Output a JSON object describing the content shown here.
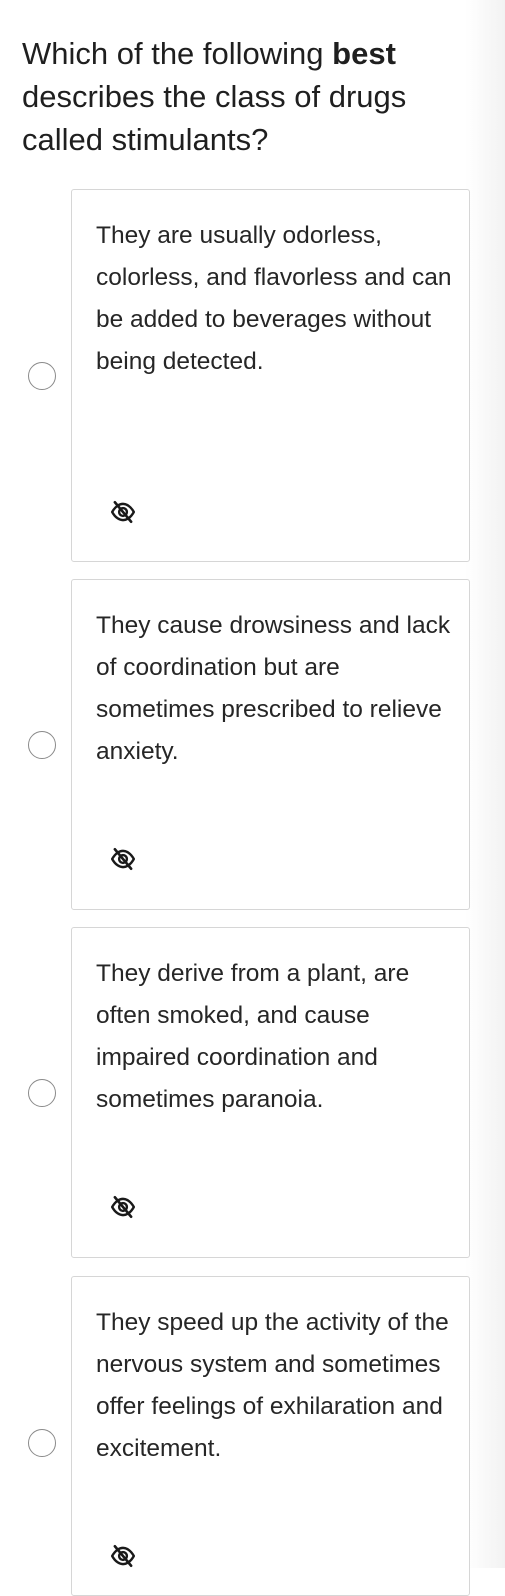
{
  "question": {
    "prefix": "Which of the following ",
    "emphasis": "best",
    "suffix": " describes the class of drugs called stimulants?"
  },
  "options": [
    {
      "text": "They are usually odorless, colorless, and flavorless and can be added to beverages without being detected.",
      "icon": "eye-off-icon"
    },
    {
      "text": "They cause drowsiness and lack of coordination but are sometimes prescribed to relieve anxiety.",
      "icon": "eye-off-icon"
    },
    {
      "text": "They derive from a plant, are often smoked, and cause impaired coordination and sometimes paranoia.",
      "icon": "eye-off-icon"
    },
    {
      "text": "They speed up the activity of the nervous system and sometimes offer feelings of exhilaration and excitement.",
      "icon": "eye-off-icon"
    }
  ],
  "colors": {
    "text": "#222222",
    "card_border": "#d6d6d6",
    "radio_border": "#8a8a8a",
    "icon": "#1a1a1a"
  }
}
